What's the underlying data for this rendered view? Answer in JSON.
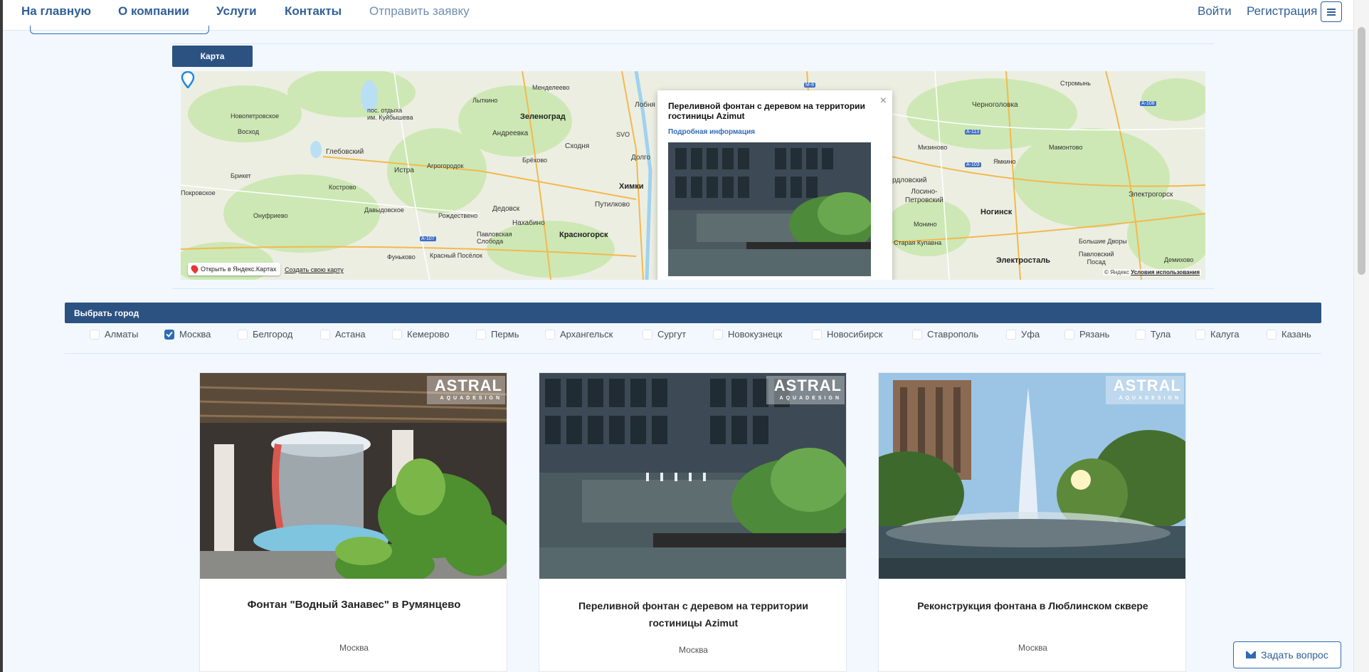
{
  "navbar": {
    "home": "На главную",
    "about": "О компании",
    "services": "Услуги",
    "contacts": "Контакты",
    "request": "Отправить заявку",
    "login": "Войти",
    "register": "Регистрация"
  },
  "map_tab": "Карта",
  "map": {
    "labels": {
      "zelenograd": "Зеленоград",
      "khimki": "Химки",
      "krasnogorsk": "Красногорск",
      "dolgo": "Долго",
      "istra": "Истра",
      "glebovsky": "Глебовский",
      "andreevka": "Андреевка",
      "skhodnya": "Сходня",
      "brekhovo": "Брёхово",
      "putilkovo": "Путилково",
      "nakhabino": "Нахабино",
      "dedovsk": "Дедовск",
      "rozhdestveno": "Рождествено",
      "pavlovskaya": "Павловская\nСлобода",
      "novopetrovskoe": "Новопетровское",
      "voskhod": "Восход",
      "briket": "Брикет",
      "kostrovo": "Кострово",
      "davydovskoe": "Давыдовское",
      "onufrievo": "Онуфриево",
      "pokrovskoe": "Покровское",
      "fenkovo": "Фуньково",
      "krasny_posyolok": "Красный Посёлок",
      "agrogorodok": "Агрогородок",
      "im_kuibysheva": "пос. отдыха\nим. Куйбышева",
      "lytkino": "Лыткино",
      "mendeleevo": "Менделеево",
      "lobnya": "Лобня",
      "noginsk": "Ногинск",
      "elektrostal": "Электросталь",
      "elektrogorsk": "Электрогорск",
      "losino": "Лосино-\nПетровский",
      "monino": "Монино",
      "staraya_kupavna": "Старая Купавна",
      "chernogolovka": "Черноголовка",
      "stromyn": "Стромынь",
      "mizinovo": "Мизиново",
      "yamkino": "Ямкино",
      "mamontovo": "Мамонтово",
      "ordlovsky": "рдловский",
      "pavlovsky_posad": "Павловский\nПосад",
      "demikhovo": "Демихово",
      "bolshie_dvory": "Большие Дворы",
      "svo": "SVO"
    },
    "open_in_yandex": "Открыть в Яндекс.Картах",
    "create_map": "Создать свою карту",
    "copyright_prefix": "© Яндекс",
    "copyright_terms": "Условия использования",
    "popup": {
      "title": "Переливной фонтан с деревом на территории гостиницы Azimut",
      "link": "Подробная информация"
    }
  },
  "city_section": {
    "title": "Выбрать город",
    "cities": [
      {
        "name": "Алматы",
        "checked": false
      },
      {
        "name": "Москва",
        "checked": true
      },
      {
        "name": "Белгород",
        "checked": false
      },
      {
        "name": "Астана",
        "checked": false
      },
      {
        "name": "Кемерово",
        "checked": false
      },
      {
        "name": "Пермь",
        "checked": false
      },
      {
        "name": "Архангельск",
        "checked": false
      },
      {
        "name": "Сургут",
        "checked": false
      },
      {
        "name": "Новокузнецк",
        "checked": false
      },
      {
        "name": "Новосибирск",
        "checked": false
      },
      {
        "name": "Ставрополь",
        "checked": false
      },
      {
        "name": "Уфа",
        "checked": false
      },
      {
        "name": "Рязань",
        "checked": false
      },
      {
        "name": "Тула",
        "checked": false
      },
      {
        "name": "Калуга",
        "checked": false
      },
      {
        "name": "Казань",
        "checked": false
      }
    ]
  },
  "cards": [
    {
      "title": "Фонтан \"Водный Занавес\" в Румянцево",
      "city": "Москва"
    },
    {
      "title": "Переливной фонтан с деревом на территории гостиницы Azimut",
      "city": "Москва"
    },
    {
      "title": "Реконструкция фонтана в Люблинском сквере",
      "city": "Москва"
    }
  ],
  "watermark": {
    "brand": "ASTRAL",
    "sub": "AQUADESIGN"
  },
  "ask_button": "Задать вопрос",
  "colors": {
    "primary": "#2c5282",
    "link": "#2f5f96",
    "page_bg": "#f2f8fe"
  }
}
